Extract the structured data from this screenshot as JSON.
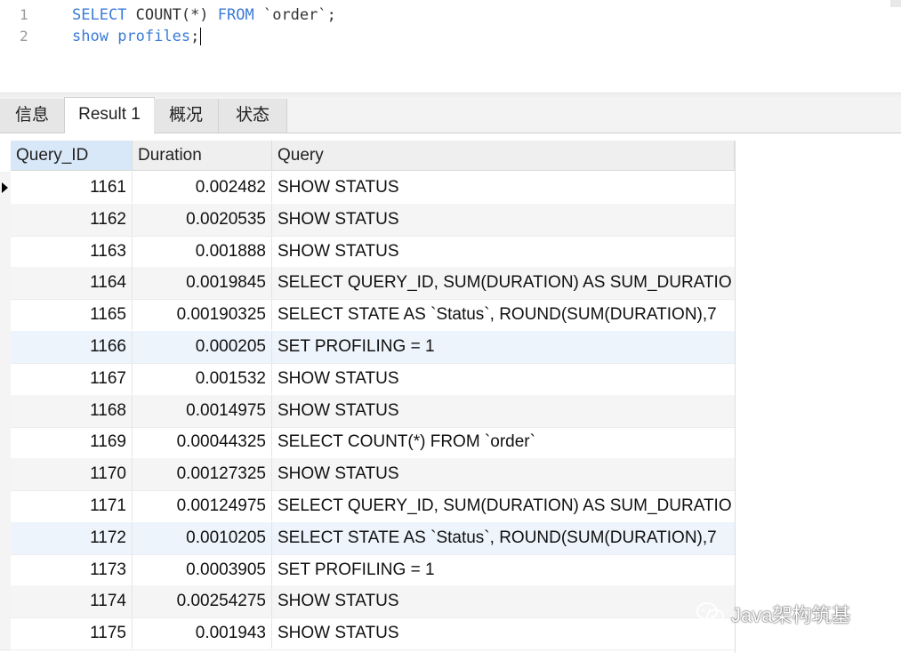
{
  "editor": {
    "lines": [
      {
        "num": "1",
        "parts": [
          {
            "t": "SELECT",
            "k": "kw"
          },
          {
            "t": " COUNT(*) ",
            "k": "tx"
          },
          {
            "t": "FROM",
            "k": "kw"
          },
          {
            "t": " `order`;",
            "k": "tx"
          }
        ]
      },
      {
        "num": "2",
        "parts": [
          {
            "t": "show",
            "k": "kw"
          },
          {
            "t": " ",
            "k": "tx"
          },
          {
            "t": "profiles",
            "k": "kw"
          },
          {
            "t": ";",
            "k": "tx"
          }
        ]
      }
    ]
  },
  "tabs": [
    {
      "label": "信息",
      "active": false
    },
    {
      "label": "Result 1",
      "active": true
    },
    {
      "label": "概况",
      "active": false
    },
    {
      "label": "状态",
      "active": false
    }
  ],
  "table": {
    "columns": [
      "Query_ID",
      "Duration",
      "Query"
    ],
    "rows": [
      [
        "1161",
        "0.002482",
        "SHOW STATUS"
      ],
      [
        "1162",
        "0.0020535",
        "SHOW STATUS"
      ],
      [
        "1163",
        "0.001888",
        "SHOW STATUS"
      ],
      [
        "1164",
        "0.0019845",
        "SELECT QUERY_ID, SUM(DURATION) AS SUM_DURATIO"
      ],
      [
        "1165",
        "0.00190325",
        "SELECT STATE AS `Status`, ROUND(SUM(DURATION),7"
      ],
      [
        "1166",
        "0.000205",
        "SET PROFILING = 1"
      ],
      [
        "1167",
        "0.001532",
        "SHOW STATUS"
      ],
      [
        "1168",
        "0.0014975",
        "SHOW STATUS"
      ],
      [
        "1169",
        "0.00044325",
        "SELECT COUNT(*) FROM `order`"
      ],
      [
        "1170",
        "0.00127325",
        "SHOW STATUS"
      ],
      [
        "1171",
        "0.00124975",
        "SELECT QUERY_ID, SUM(DURATION) AS SUM_DURATIO"
      ],
      [
        "1172",
        "0.0010205",
        "SELECT STATE AS `Status`, ROUND(SUM(DURATION),7"
      ],
      [
        "1173",
        "0.0003905",
        "SET PROFILING = 1"
      ],
      [
        "1174",
        "0.00254275",
        "SHOW STATUS"
      ],
      [
        "1175",
        "0.001943",
        "SHOW STATUS"
      ]
    ],
    "selected_row": 0
  },
  "watermark": {
    "text": "Java架构筑基",
    "icon": "wechat-icon"
  },
  "colors": {
    "keyword": "#3b7bd8",
    "header_selected": "#d9e8f8"
  }
}
